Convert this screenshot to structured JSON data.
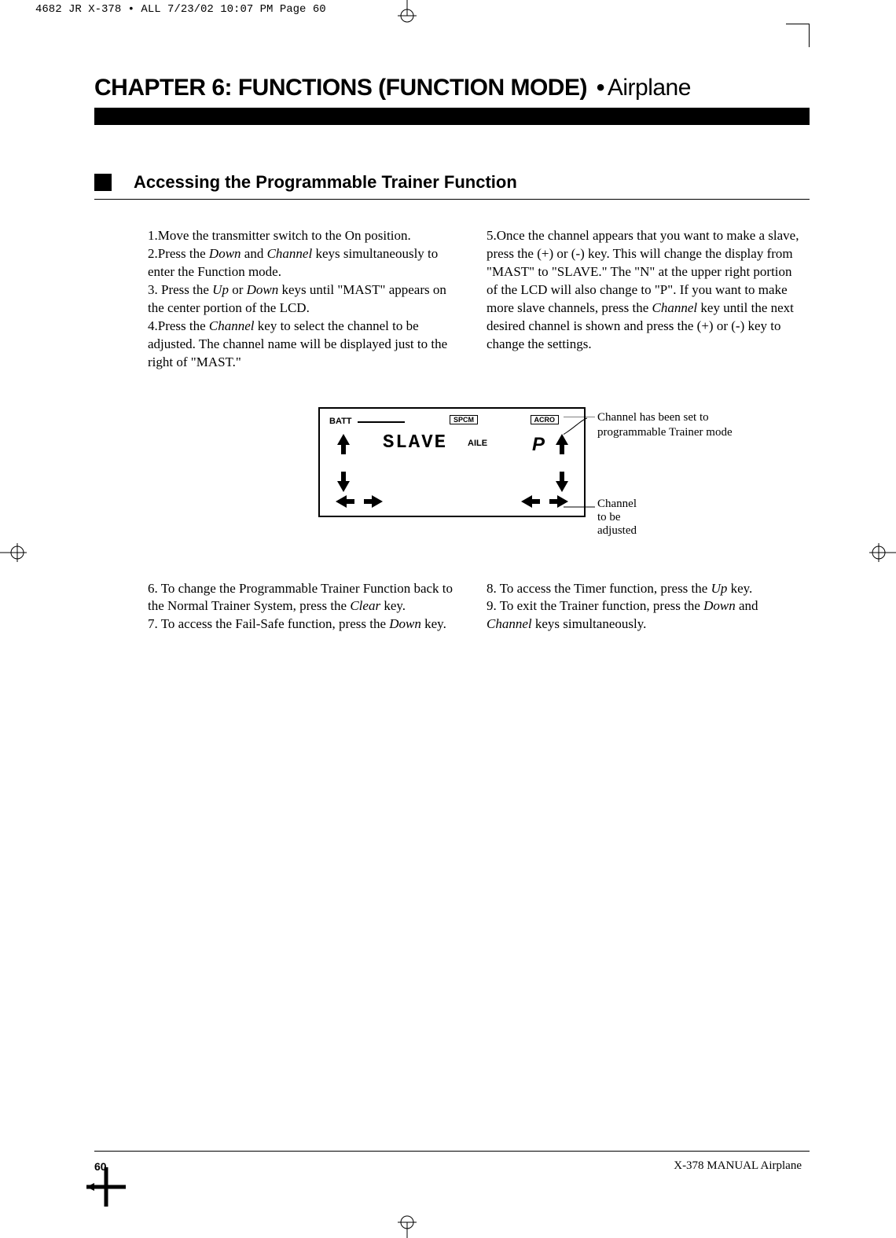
{
  "print_header": "4682 JR X-378 • ALL  7/23/02  10:07 PM  Page 60",
  "chapter": {
    "title": "CHAPTER 6: FUNCTIONS (FUNCTION MODE)",
    "separator": "•",
    "subtitle": "Airplane"
  },
  "section": {
    "title": "Accessing the Programmable Trainer Function"
  },
  "body": {
    "col1a_1": "1.Move the transmitter switch to the On position.",
    "col1a_2a": "2.Press the ",
    "col1a_2b": "Down",
    "col1a_2c": " and ",
    "col1a_2d": "Channel",
    "col1a_2e": " keys simultaneously to enter the Function mode.",
    "col1a_3a": "3. Press the ",
    "col1a_3b": "Up",
    "col1a_3c": " or ",
    "col1a_3d": "Down",
    "col1a_3e": " keys until \"MAST\" appears on the center portion of the LCD.",
    "col1a_4a": "4.Press the ",
    "col1a_4b": "Channel",
    "col1a_4c": " key to select the channel to be adjusted. The channel name will be displayed just to the right of \"MAST.\"",
    "col2a_5a": "5.Once the channel appears that you want to make a slave, press the (+) or (-) key. This will change the display from \"MAST\" to \"SLAVE.\" The \"N\" at the upper right portion of the LCD will also change to \"P\". If you want to make more slave channels, press the ",
    "col2a_5b": "Channel",
    "col2a_5c": " key until the next desired channel is shown and press the (+) or (-) key to change the settings.",
    "col1b_6a": "6. To change the Programmable Trainer Function back to the  Normal Trainer System, press the ",
    "col1b_6b": "Clear",
    "col1b_6c": " key.",
    "col1b_7a": "7. To access the Fail-Safe function, press the ",
    "col1b_7b": "Down",
    "col1b_7c": " key.",
    "col2b_8a": "8. To access the Timer function, press the ",
    "col2b_8b": "Up",
    "col2b_8c": " key.",
    "col2b_9a": "9. To exit the Trainer function, press the ",
    "col2b_9b": "Down",
    "col2b_9c": " and ",
    "col2b_9d": "Channel",
    "col2b_9e": " keys simultaneously."
  },
  "lcd": {
    "batt": "BATT",
    "spcm": "SPCM",
    "acro": "ACRO",
    "slave": "SLAVE",
    "aile": "AILE",
    "p": "P"
  },
  "callouts": {
    "c1": "Channel has been set to programmable Trainer mode",
    "c2": "Channel to be adjusted"
  },
  "footer": {
    "page": "60",
    "text": "X-378  MANUAL Airplane"
  }
}
